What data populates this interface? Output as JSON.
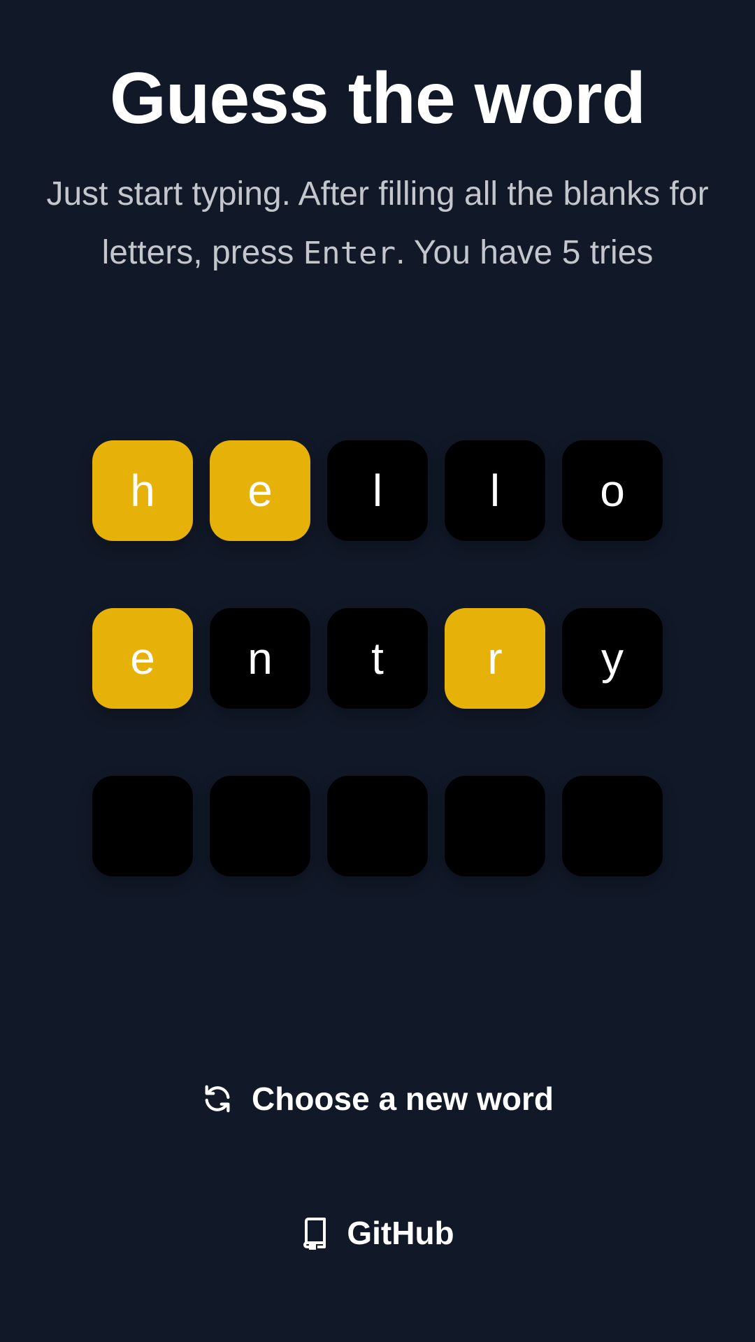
{
  "title": "Guess the word",
  "instructions": {
    "before": "Just start typing. After filling all the blanks for letters, press ",
    "key": "Enter",
    "after": ". You have 5 tries"
  },
  "colors": {
    "background": "#111827",
    "present": "#e6b108",
    "absent": "#000000"
  },
  "board": [
    [
      {
        "letter": "h",
        "state": "present"
      },
      {
        "letter": "e",
        "state": "present"
      },
      {
        "letter": "l",
        "state": "absent"
      },
      {
        "letter": "l",
        "state": "absent"
      },
      {
        "letter": "o",
        "state": "absent"
      }
    ],
    [
      {
        "letter": "e",
        "state": "present"
      },
      {
        "letter": "n",
        "state": "absent"
      },
      {
        "letter": "t",
        "state": "absent"
      },
      {
        "letter": "r",
        "state": "present"
      },
      {
        "letter": "y",
        "state": "absent"
      }
    ],
    [
      {
        "letter": "",
        "state": "empty"
      },
      {
        "letter": "",
        "state": "empty"
      },
      {
        "letter": "",
        "state": "empty"
      },
      {
        "letter": "",
        "state": "empty"
      },
      {
        "letter": "",
        "state": "empty"
      }
    ]
  ],
  "actions": {
    "new_word": {
      "label": "Choose a new word",
      "icon": "refresh-icon"
    },
    "github": {
      "label": "GitHub",
      "icon": "repo-icon"
    }
  }
}
